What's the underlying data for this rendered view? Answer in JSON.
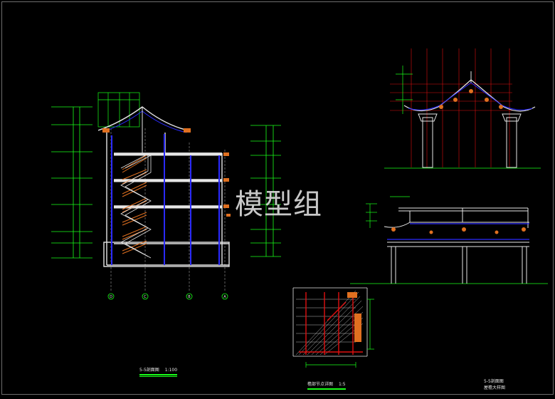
{
  "watermark": "模型组",
  "drawings": {
    "section_5_5": {
      "title": "5-5剖面图",
      "scale": "1:100",
      "grid_axes": [
        "D",
        "C",
        "B",
        "A"
      ]
    },
    "eave_detail": {
      "title": "檐部节点详图",
      "scale": "1:5"
    },
    "right_elevation": {
      "title": "5-5剖面图",
      "subtitle": "屋檐大样图"
    }
  },
  "colors": {
    "background": "#000000",
    "grid_green": "#19ff19",
    "axis_red": "#e01010",
    "structure_blue": "#2a2aff",
    "outline_white": "#e6e6e6",
    "bracket_orange": "#e07020",
    "grey": "#9a9a9a"
  }
}
